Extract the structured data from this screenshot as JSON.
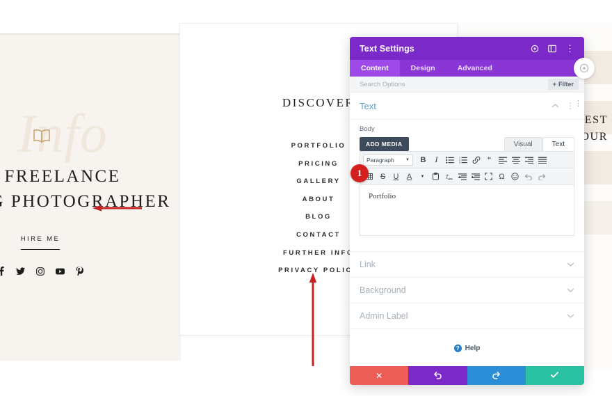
{
  "website": {
    "left_panel": {
      "watermark": "Info",
      "icon": "open-book-icon",
      "title_line1": "FREELANCE",
      "title_line2": "DING PHOTOGRAPHER",
      "cta_label": "HIRE ME",
      "social_icons": [
        "facebook-icon",
        "twitter-icon",
        "instagram-icon",
        "youtube-icon",
        "pinterest-icon"
      ],
      "background_color": "#f7f3ee"
    },
    "middle_card": {
      "heading": "DISCOVER",
      "menu_items": [
        "PORTFOLIO",
        "PRICING",
        "GALLERY",
        "ABOUT",
        "BLOG",
        "CONTACT",
        "FURTHER INFO",
        "PRIVACY POLICY"
      ]
    },
    "right_panel": {
      "text_line1": "EST",
      "text_line2": "OUR",
      "band_color": "#efe7dc"
    }
  },
  "panel": {
    "title": "Text Settings",
    "title_icons": [
      "target-icon",
      "layout-panel-icon",
      "kebab-menu-icon"
    ],
    "tabs": [
      {
        "label": "Content",
        "active": true
      },
      {
        "label": "Design",
        "active": false
      },
      {
        "label": "Advanced",
        "active": false
      }
    ],
    "search_placeholder": "Search Options",
    "filter_label": "Filter",
    "section": {
      "title": "Text",
      "collapse_icon": "chevron-up-icon",
      "menu_icon": "kebab-menu-icon"
    },
    "body_field": {
      "label": "Body",
      "add_media_label": "ADD MEDIA",
      "editor_tabs": [
        {
          "label": "Visual",
          "active": false
        },
        {
          "label": "Text",
          "active": true
        }
      ],
      "format_select": "Paragraph",
      "toolbar_row1": [
        "bold-icon",
        "italic-icon",
        "bulleted-list-icon",
        "numbered-list-icon",
        "link-icon",
        "blockquote-icon",
        "align-left-icon",
        "align-center-icon",
        "align-right-icon",
        "align-justify-icon"
      ],
      "toolbar_row2": [
        "table-icon",
        "strikethrough-icon",
        "underline-icon",
        "text-color-icon",
        "paste-as-text-icon",
        "clear-formatting-icon",
        "outdent-icon",
        "indent-icon",
        "fullscreen-icon",
        "special-character-icon",
        "emoji-icon",
        "undo-icon",
        "redo-icon"
      ],
      "content": "Portfolio"
    },
    "accordions": [
      {
        "label": "Link",
        "icon": "chevron-down-icon"
      },
      {
        "label": "Background",
        "icon": "chevron-down-icon"
      },
      {
        "label": "Admin Label",
        "icon": "chevron-down-icon"
      }
    ],
    "help_label": "Help",
    "footer_buttons": [
      {
        "name": "cancel",
        "icon": "close-x-icon",
        "color": "#ec5d57"
      },
      {
        "name": "undo",
        "icon": "undo-arrow-icon",
        "color": "#7b29c9"
      },
      {
        "name": "redo",
        "icon": "redo-arrow-icon",
        "color": "#2a8fd6"
      },
      {
        "name": "save",
        "icon": "checkmark-icon",
        "color": "#2bc2a4"
      }
    ]
  },
  "annotations": {
    "badge_number": "1",
    "badge_color": "#d41f1f",
    "arrow_color": "#c62222"
  }
}
